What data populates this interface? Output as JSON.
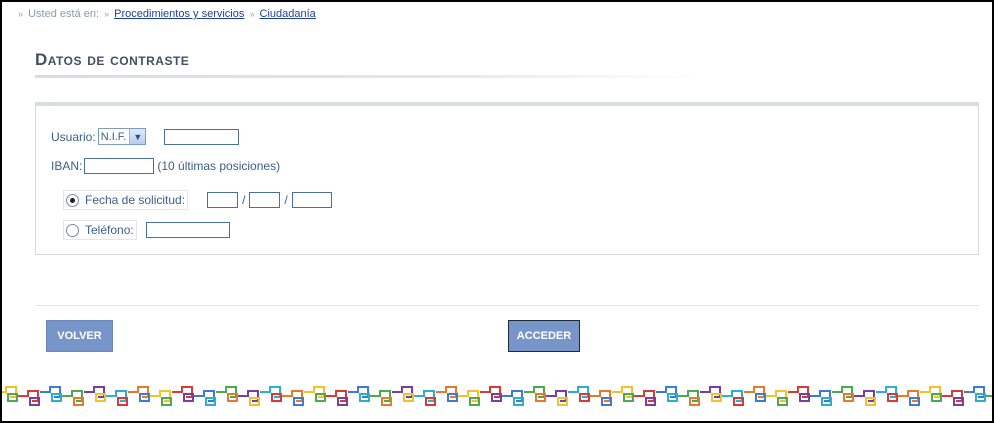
{
  "breadcrumb": {
    "prefix": "Usted está en:",
    "items": [
      "Procedimientos y servicios",
      "Ciudadanía"
    ],
    "separator": "»"
  },
  "page": {
    "title": "Datos de contraste"
  },
  "form": {
    "user_label": "Usuario:",
    "id_type_selected": "N.I.F.",
    "iban_label": "IBAN:",
    "iban_hint": "(10 últimas posiciones)",
    "date_label": "Fecha de solicitud:",
    "date_separator": "/",
    "phone_label": "Teléfono:",
    "date_option_selected": true
  },
  "actions": {
    "back_label": "VOLVER",
    "submit_label": "ACCEDER"
  },
  "colors": {
    "button": "#7895c9",
    "text": "#3b5f8a",
    "link": "#1f3f9f",
    "chain": [
      "#f2c12e",
      "#d83a3a",
      "#3f7bd6",
      "#4ea84f",
      "#7a3f9c",
      "#2fb0c9",
      "#e8782a"
    ]
  }
}
